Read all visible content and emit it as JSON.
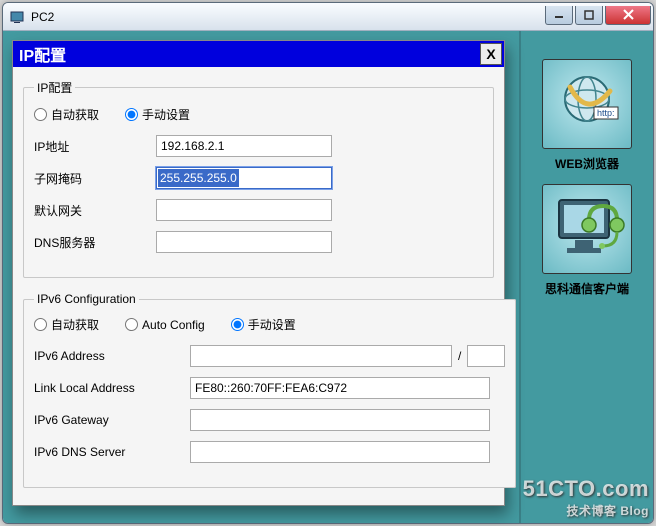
{
  "window": {
    "title": "PC2"
  },
  "dialog": {
    "title": "IP配置",
    "close_label": "X",
    "ipv4": {
      "legend": "IP配置",
      "radio_auto": "自动获取",
      "radio_manual": "手动设置",
      "ip_label": "IP地址",
      "ip_value": "192.168.2.1",
      "subnet_label": "子网掩码",
      "subnet_value": "255.255.255.0",
      "gateway_label": "默认网关",
      "gateway_value": "",
      "dns_label": "DNS服务器",
      "dns_value": ""
    },
    "ipv6": {
      "legend": "IPv6 Configuration",
      "radio_auto": "自动获取",
      "radio_autoconfig": "Auto Config",
      "radio_manual": "手动设置",
      "addr_label": "IPv6 Address",
      "addr_value": "",
      "prefix_value": "",
      "link_local_label": "Link Local Address",
      "link_local_value": "FE80::260:70FF:FEA6:C972",
      "gateway_label": "IPv6 Gateway",
      "gateway_value": "",
      "dns_label": "IPv6 DNS Server",
      "dns_value": ""
    }
  },
  "apps": {
    "web_browser": "WEB浏览器",
    "cisco_client": "思科通信客户端"
  },
  "watermark": {
    "main": "51CTO.com",
    "sub": "技术博客  Blog"
  }
}
